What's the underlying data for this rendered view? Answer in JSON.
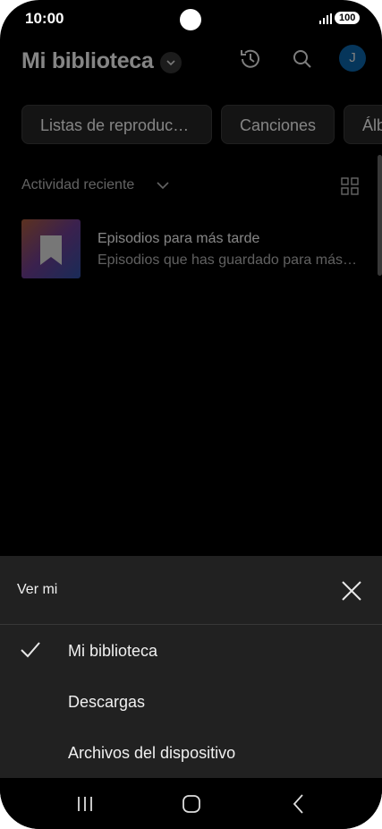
{
  "status": {
    "time": "10:00",
    "battery": "100"
  },
  "header": {
    "title": "Mi biblioteca"
  },
  "chips": [
    "Listas de reproduc…",
    "Canciones",
    "Álb"
  ],
  "recent": {
    "label": "Actividad reciente"
  },
  "item": {
    "title": "Episodios para más tarde",
    "subtitle": "Episodios que has guardado para más…"
  },
  "avatar": {
    "letter": "J"
  },
  "sheet": {
    "title": "Ver mi",
    "options": [
      "Mi biblioteca",
      "Descargas",
      "Archivos del dispositivo"
    ],
    "selected": "Mi biblioteca"
  },
  "icons": {
    "history": "history-icon",
    "search": "search-icon",
    "grid": "grid-view-icon",
    "close": "close-icon",
    "check": "check-icon",
    "bookmark": "bookmark-icon",
    "recents": "recents-nav-icon",
    "home": "home-nav-icon",
    "back": "back-nav-icon"
  },
  "colors": {
    "avatar": "#0b63a6",
    "sheet_bg": "#212121",
    "page_bg": "#000000"
  }
}
